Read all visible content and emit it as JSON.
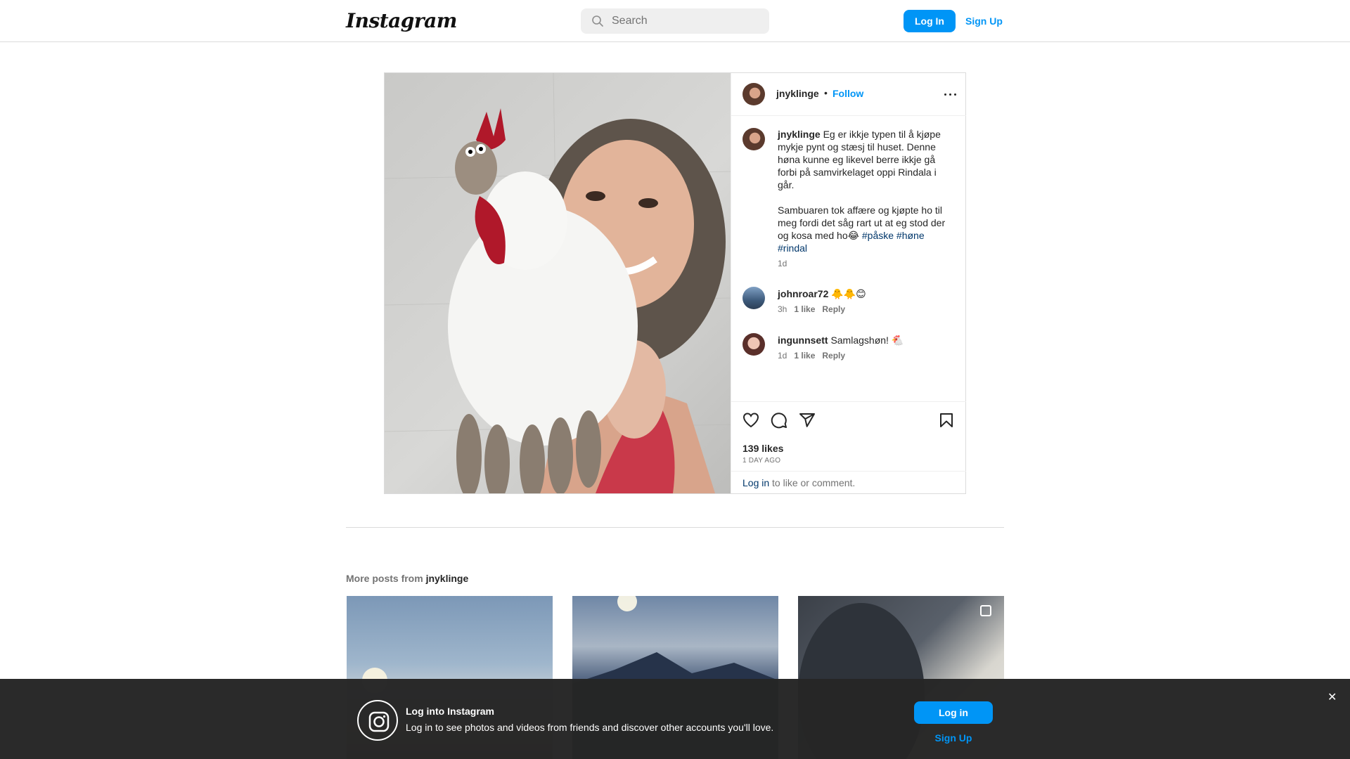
{
  "header": {
    "logo_text": "Instagram",
    "search_placeholder": "Search",
    "login_label": "Log In",
    "signup_label": "Sign Up"
  },
  "post": {
    "author": "jnyklinge",
    "separator": "•",
    "follow_label": "Follow",
    "caption_line1": "Eg er ikkje typen til å kjøpe mykje pynt og stæsj til huset. Denne høna kunne eg likevel berre ikkje gå forbi på samvirkelaget oppi Rindala i går.",
    "caption_line2": "Sambuaren tok affære og kjøpte ho til meg fordi det såg rart ut at eg stod der og kosa med ho😂 ",
    "hashtags": [
      "#påske",
      "#høne",
      "#rindal"
    ],
    "caption_time": "1d",
    "comments": [
      {
        "user": "johnroar72",
        "text": "🐥🐥😊",
        "time": "3h",
        "likes": "1 like",
        "reply": "Reply"
      },
      {
        "user": "ingunnsett",
        "text": "Samlagshøn! 🐔",
        "time": "1d",
        "likes": "1 like",
        "reply": "Reply"
      }
    ],
    "likes_count": "139 likes",
    "posted_ago": "1 DAY AGO",
    "login_link": "Log in",
    "login_suffix": " to like or comment."
  },
  "more_posts": {
    "prefix": "More posts from ",
    "user": "jnyklinge"
  },
  "banner": {
    "title": "Log into Instagram",
    "text": "Log in to see photos and videos from friends and discover other accounts you'll love.",
    "login_label": "Log in",
    "signup_label": "Sign Up",
    "close_symbol": "✕"
  },
  "colors": {
    "accent": "#0095f6",
    "hashtag": "#00376b",
    "banner_bg": "#262626"
  }
}
